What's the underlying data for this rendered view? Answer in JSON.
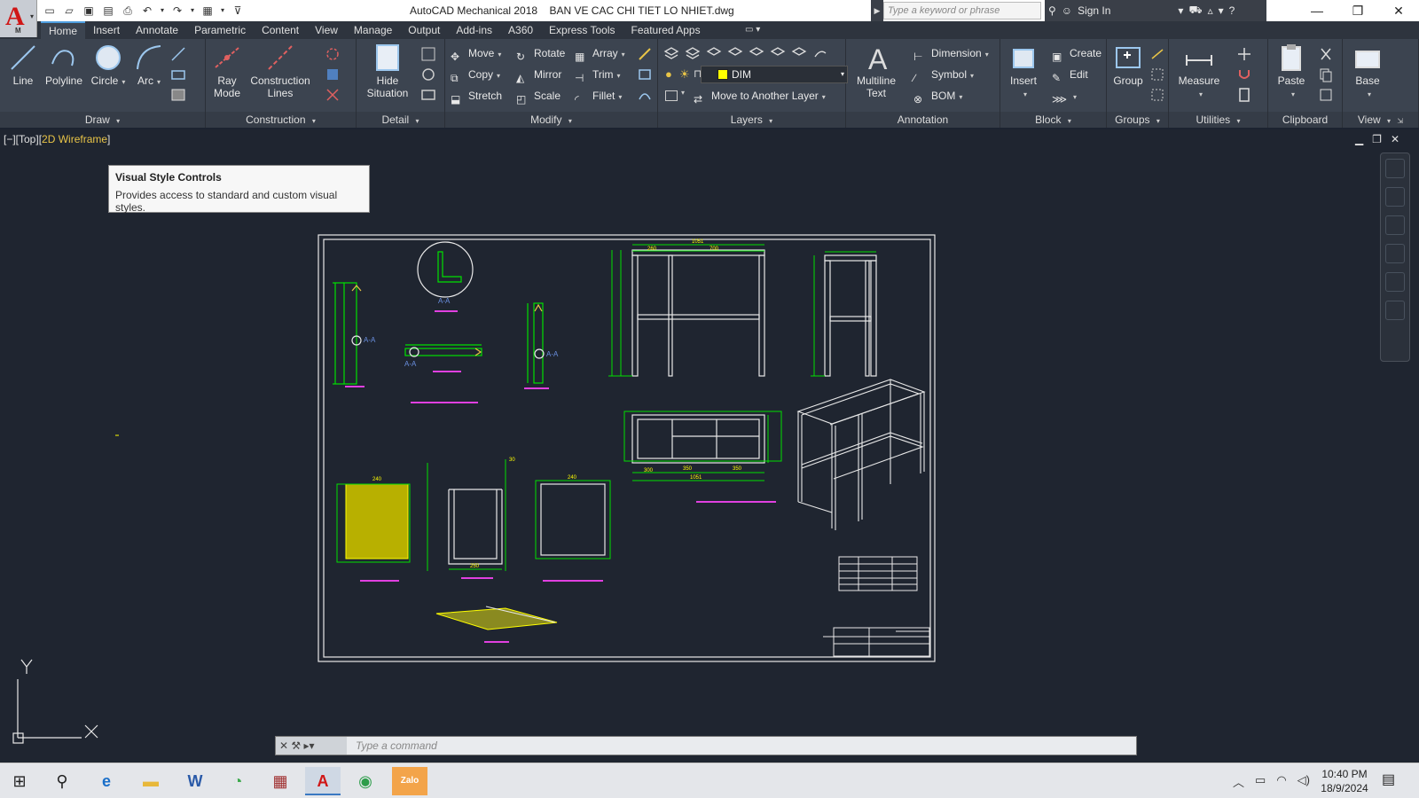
{
  "titlebar": {
    "app_name": "AutoCAD Mechanical 2018",
    "file_name": "BAN VE CAC CHI TIET LO NHIET.dwg",
    "search_placeholder": "Type a keyword or phrase",
    "sign_in": "Sign In"
  },
  "tabs": [
    "Home",
    "Insert",
    "Annotate",
    "Parametric",
    "Content",
    "View",
    "Manage",
    "Output",
    "Add-ins",
    "A360",
    "Express Tools",
    "Featured Apps"
  ],
  "active_tab": "Home",
  "ribbon": {
    "draw": {
      "label": "Draw",
      "line": "Line",
      "polyline": "Polyline",
      "circle": "Circle",
      "arc": "Arc"
    },
    "construction": {
      "label": "Construction",
      "ray_mode_1": "Ray",
      "ray_mode_2": "Mode",
      "construction_lines_1": "Construction",
      "construction_lines_2": "Lines"
    },
    "detail": {
      "label": "Detail",
      "hide_situation_1": "Hide",
      "hide_situation_2": "Situation"
    },
    "modify": {
      "label": "Modify",
      "move": "Move",
      "rotate": "Rotate",
      "array": "Array",
      "copy": "Copy",
      "mirror": "Mirror",
      "trim": "Trim",
      "stretch": "Stretch",
      "scale": "Scale",
      "fillet": "Fillet"
    },
    "layers": {
      "label": "Layers",
      "current_layer": "DIM",
      "move_to_layer": "Move to Another Layer"
    },
    "annotation": {
      "label": "Annotation",
      "multiline_1": "Multiline",
      "multiline_2": "Text",
      "dimension": "Dimension",
      "symbol": "Symbol",
      "bom": "BOM"
    },
    "block": {
      "label": "Block",
      "insert": "Insert",
      "create": "Create",
      "edit": "Edit"
    },
    "groups": {
      "label": "Groups",
      "group": "Group"
    },
    "utilities": {
      "label": "Utilities",
      "measure": "Measure"
    },
    "clipboard": {
      "label": "Clipboard",
      "paste": "Paste"
    },
    "view": {
      "label": "View",
      "base": "Base"
    }
  },
  "viewport": {
    "prefix": "[−][Top][",
    "visual_style": "2D Wireframe",
    "suffix": "]"
  },
  "tooltip": {
    "title": "Visual Style Controls",
    "body": "Provides access to standard and custom visual styles."
  },
  "drawing_labels": {
    "section_aa_1": "A-A",
    "section_aa_2": "A-A",
    "section_aa_3": "A-A",
    "section_aa_4": "A-A",
    "dim_1051_top": "1051",
    "dim_700": "700",
    "dim_260": "260",
    "dim_350a": "350",
    "dim_350b": "350",
    "dim_1051_bot": "1051",
    "dim_300": "300",
    "dim_240a": "240",
    "dim_240b": "240",
    "dim_250": "250",
    "dim_30": "30",
    "dim_40": "40",
    "dim_20": "20"
  },
  "command": {
    "placeholder": "Type a command"
  },
  "taskbar": {
    "time": "10:40 PM",
    "date": "18/9/2024"
  },
  "colors": {
    "accent": "#4f9fe0",
    "drawing_line": "#00e000",
    "dim": "#ffff00",
    "label": "#e040e0",
    "frame": "#e8e8e8",
    "canvas": "#1f2530"
  }
}
